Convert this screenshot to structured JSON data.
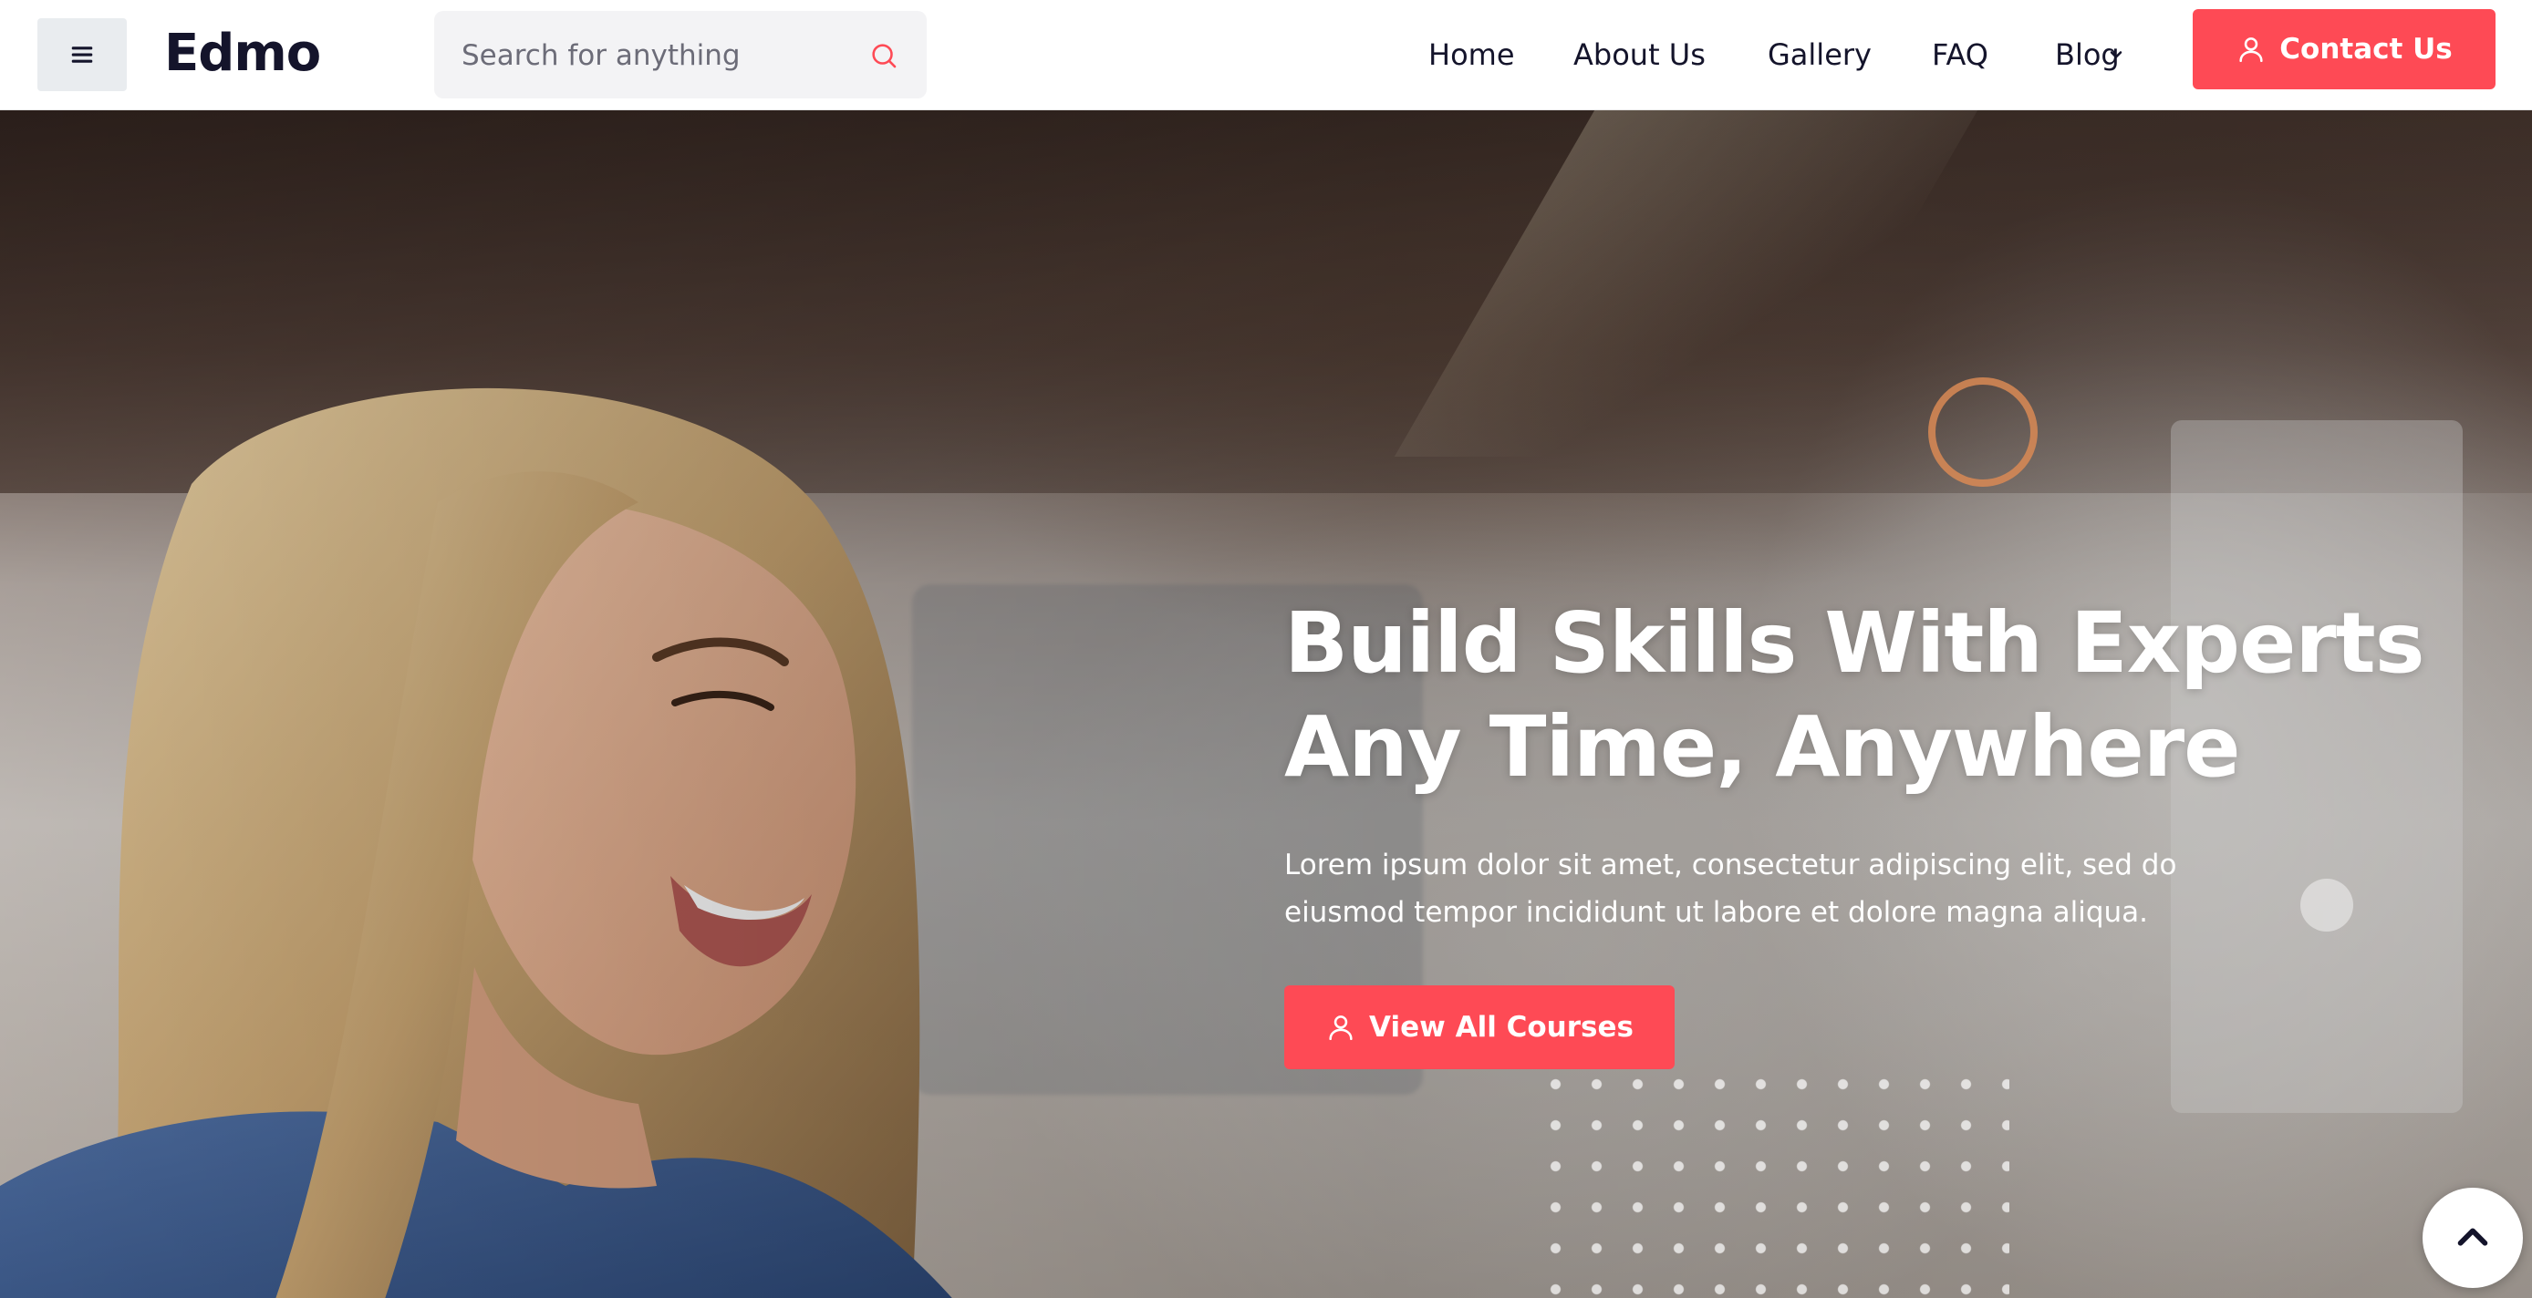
{
  "header": {
    "menu_icon": "hamburger-menu-icon",
    "logo": "Edmo",
    "search": {
      "placeholder": "Search for anything",
      "value": ""
    },
    "nav": [
      {
        "label": "Home"
      },
      {
        "label": "About Us"
      },
      {
        "label": "Gallery"
      },
      {
        "label": "FAQ"
      },
      {
        "label": "Blog",
        "has_dropdown": true
      }
    ],
    "contact_button": "Contact Us"
  },
  "hero": {
    "title_line1": "Build Skills With Experts",
    "title_line2": "Any Time, Anywhere",
    "text_line1": "Lorem ipsum dolor sit amet, consectetur adipiscing elit, sed do",
    "text_line2": "eiusmod tempor incididunt ut labore et dolore magna aliqua.",
    "cta_button": "View All Courses"
  },
  "colors": {
    "accent": "#fe4a55",
    "dark_text": "#14142b",
    "search_bg": "#f3f3f5",
    "deco_circle": "#d98a55"
  }
}
